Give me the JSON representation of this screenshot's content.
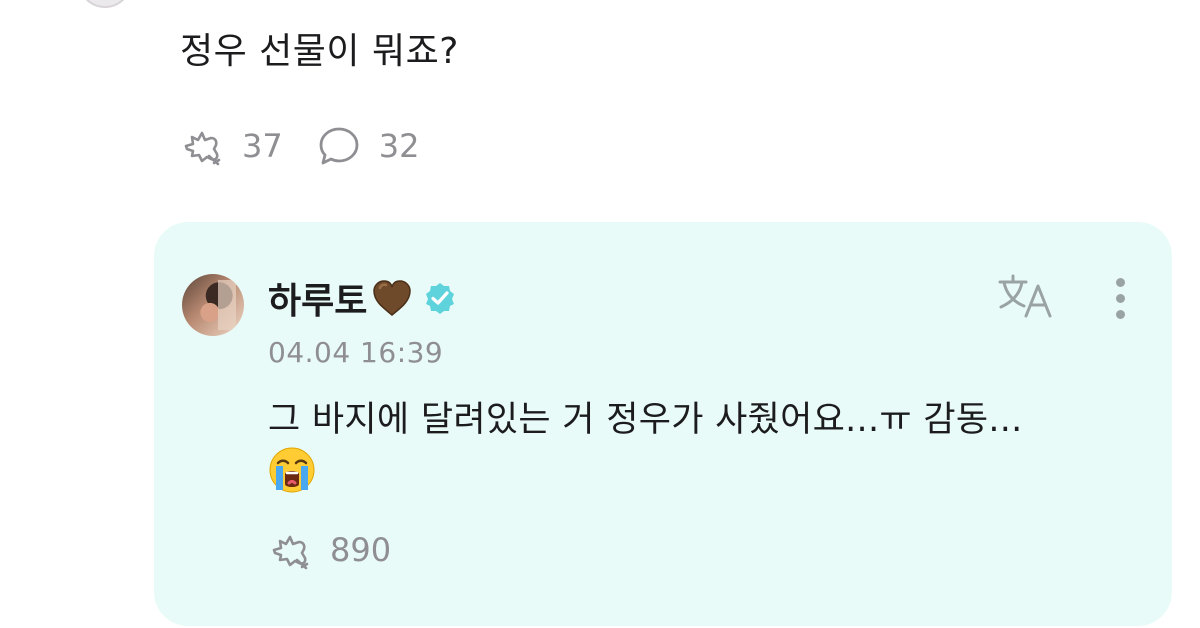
{
  "post": {
    "question_text": "정우 선물이 뭐죠?",
    "likes_count": "37",
    "comments_count": "32"
  },
  "reply": {
    "artist_name": "하루토",
    "name_emoji": "brown-heart",
    "verified_icon": "verified-badge-icon",
    "timestamp": "04.04 16:39",
    "text": "그 바지에 달려있는 거 정우가 사줬어요...ㅠ 감동...",
    "trailing_emoji": "loudly-crying-face",
    "likes_count": "890"
  },
  "icons": {
    "like": "like-reaction-icon",
    "comment": "comment-bubble-icon",
    "translate": "translate-icon",
    "more": "more-vertical-icon"
  },
  "colors": {
    "card_background": "#e9fbf8",
    "verified": "#5fd3dc",
    "muted_text": "#8e8e93",
    "primary_text": "#1c1c1e"
  }
}
